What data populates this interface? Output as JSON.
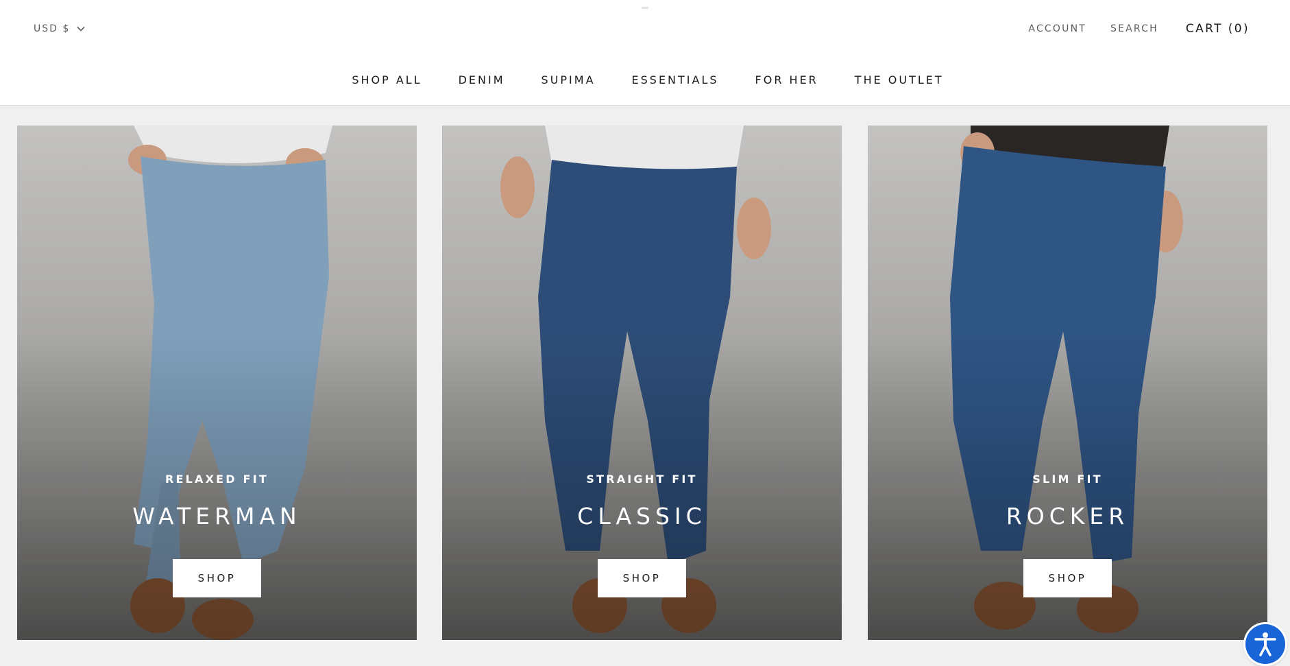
{
  "header": {
    "currency": "USD $",
    "account_label": "ACCOUNT",
    "search_label": "SEARCH",
    "cart_label": "CART (0)"
  },
  "nav": {
    "items": [
      "SHOP ALL",
      "DENIM",
      "SUPIMA",
      "ESSENTIALS",
      "FOR HER",
      "THE OUTLET"
    ]
  },
  "collections": [
    {
      "subtitle": "RELAXED FIT",
      "title": "WATERMAN",
      "button": "SHOP",
      "denim_color": "#7f9fbb",
      "shirt_color": "#e9e9ea"
    },
    {
      "subtitle": "STRAIGHT FIT",
      "title": "CLASSIC",
      "button": "SHOP",
      "denim_color": "#2d4d78",
      "shirt_color": "#e9e9ea"
    },
    {
      "subtitle": "SLIM FIT",
      "title": "ROCKER",
      "button": "SHOP",
      "denim_color": "#2f5585",
      "shirt_color": "#2a2624"
    }
  ],
  "accessibility": {
    "icon": "accessibility-icon",
    "color": "#1964d6"
  }
}
